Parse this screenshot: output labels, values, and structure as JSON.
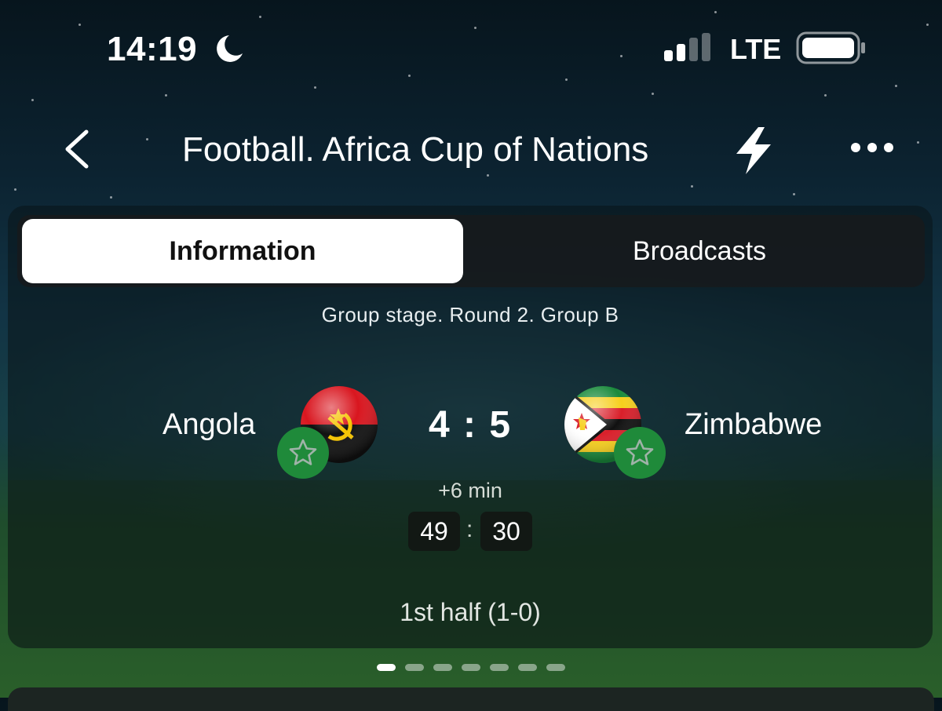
{
  "status_bar": {
    "time": "14:19",
    "moon_icon": "moon-icon",
    "signal_icon": "cellular-signal-icon",
    "network": "LTE",
    "battery_icon": "battery-icon"
  },
  "nav": {
    "back_icon": "chevron-left-icon",
    "title": "Football. Africa Cup of Nations",
    "bolt_icon": "lightning-bolt-icon",
    "more_icon": "more-horizontal-icon"
  },
  "tabs": [
    {
      "label": "Information",
      "active": true
    },
    {
      "label": "Broadcasts",
      "active": false
    }
  ],
  "match": {
    "stage": "Group stage. Round 2. Group B",
    "home_team": {
      "name": "Angola",
      "flag_icon": "angola-flag-icon",
      "favorite_icon": "star-outline-icon"
    },
    "away_team": {
      "name": "Zimbabwe",
      "flag_icon": "zimbabwe-flag-icon",
      "favorite_icon": "star-outline-icon"
    },
    "score": "4 : 5",
    "added_time": "+6 min",
    "clock": {
      "minutes": "49",
      "separator": ":",
      "seconds": "30"
    },
    "period": "1st half (1-0)"
  },
  "pager": {
    "count": 7,
    "active_index": 0
  },
  "colors": {
    "favorite_green": "#1f8a3a",
    "active_tab_bg": "#ffffff",
    "card_bg": "#0a1418"
  }
}
